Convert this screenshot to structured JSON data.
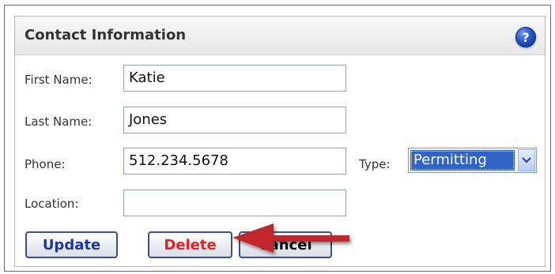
{
  "panel": {
    "title": "Contact Information",
    "help_icon_glyph": "?"
  },
  "form": {
    "first_name": {
      "label": "First Name:",
      "value": "Katie"
    },
    "last_name": {
      "label": "Last Name:",
      "value": "Jones"
    },
    "phone": {
      "label": "Phone:",
      "value": "512.234.5678"
    },
    "type": {
      "label": "Type:",
      "selected": "Permitting"
    },
    "location": {
      "label": "Location:",
      "value": ""
    }
  },
  "buttons": {
    "update": "Update",
    "delete": "Delete",
    "cancel": "Cancel"
  },
  "icons": {
    "help": "help-icon",
    "dropdown": "chevron-down-icon",
    "annotation": "red-arrow-annotation"
  },
  "colors": {
    "annotation_arrow": "#c0262c",
    "select_highlight": "#3063c6",
    "delete_text": "#e82020",
    "update_text": "#1c36a0"
  }
}
